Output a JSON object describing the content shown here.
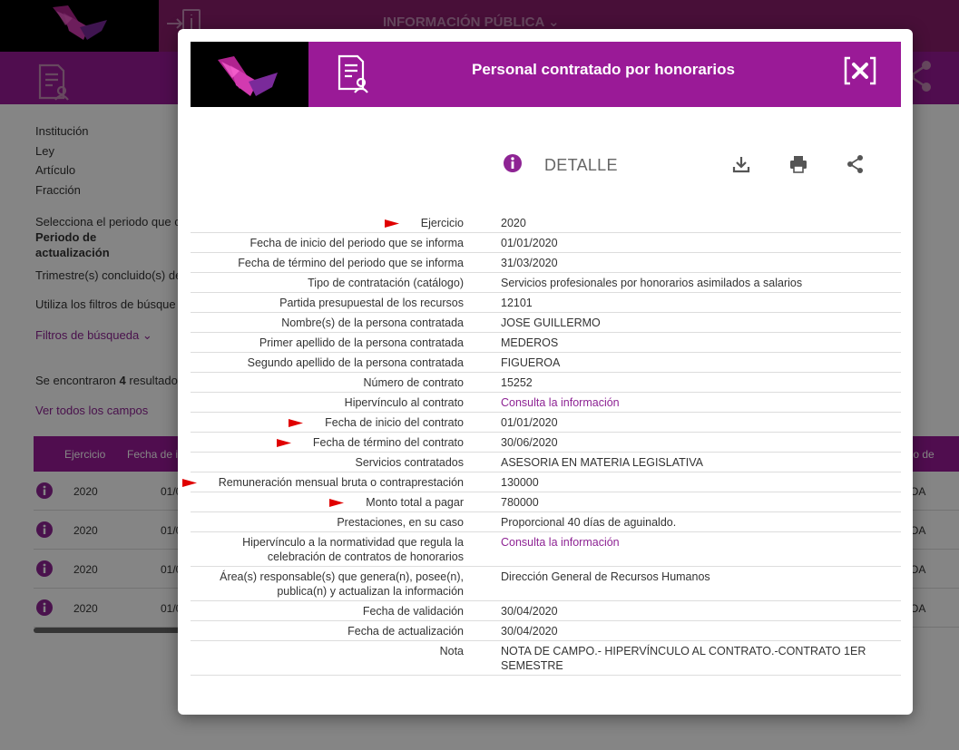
{
  "nav": {
    "section_label": "INFORMACIÓN PÚBLICA"
  },
  "background": {
    "fields": [
      "Institución",
      "Ley",
      "Artículo",
      "Fracción"
    ],
    "period_select_text": "Selecciona el periodo que c",
    "period_label_line1": "Periodo de",
    "period_label_line2": "actualización",
    "quarter_text": "Trimestre(s) concluido(s) de",
    "filters_hint": "Utiliza los filtros de búsque",
    "filters_link": "Filtros de búsqueda",
    "results_prefix": "Se encontraron",
    "results_count": "4",
    "results_suffix": "resultado",
    "see_all_link": "Ver todos los campos",
    "table_headers": [
      "Ejercicio",
      "Fecha de ini",
      "ido de"
    ],
    "table_rows": [
      {
        "year": "2020",
        "date": "01/0",
        "tail": "OA"
      },
      {
        "year": "2020",
        "date": "01/0",
        "tail": "OA"
      },
      {
        "year": "2020",
        "date": "01/0",
        "tail": "OA"
      },
      {
        "year": "2020",
        "date": "01/0",
        "tail": "OA"
      }
    ]
  },
  "modal": {
    "title": "Personal contratado por honorarios",
    "detail_title": "DETALLE",
    "colors": {
      "accent": "#9a1a97",
      "link": "#8e2494",
      "flag": "#e00000"
    },
    "rows": [
      {
        "label": "Ejercicio",
        "value": "2020",
        "flag": true
      },
      {
        "label": "Fecha de inicio del periodo que se informa",
        "value": "01/01/2020"
      },
      {
        "label": "Fecha de término del periodo que se informa",
        "value": "31/03/2020"
      },
      {
        "label": "Tipo de contratación (catálogo)",
        "value": "Servicios profesionales por honorarios asimilados a salarios"
      },
      {
        "label": "Partida presupuestal de los recursos",
        "value": "12101"
      },
      {
        "label": "Nombre(s) de la persona contratada",
        "value": "JOSE GUILLERMO"
      },
      {
        "label": "Primer apellido de la persona contratada",
        "value": "MEDEROS"
      },
      {
        "label": "Segundo apellido de la persona contratada",
        "value": "FIGUEROA"
      },
      {
        "label": "Número de contrato",
        "value": "15252"
      },
      {
        "label": "Hipervínculo al contrato",
        "value": "Consulta la información",
        "link": true
      },
      {
        "label": "Fecha de inicio del contrato",
        "value": "01/01/2020",
        "flag": true
      },
      {
        "label": "Fecha de término del contrato",
        "value": "30/06/2020",
        "flag": true
      },
      {
        "label": "Servicios contratados",
        "value": "ASESORIA EN MATERIA LEGISLATIVA"
      },
      {
        "label": "Remuneración mensual bruta o contraprestación",
        "value": "130000",
        "flag": true
      },
      {
        "label": "Monto total a pagar",
        "value": "780000",
        "flag": true
      },
      {
        "label": "Prestaciones, en su caso",
        "value": "Proporcional 40 días de aguinaldo."
      },
      {
        "label": "Hipervínculo a la normatividad que regula la celebración de contratos de honorarios",
        "value": "Consulta la información",
        "link": true
      },
      {
        "label": "Área(s) responsable(s) que genera(n), posee(n), publica(n) y actualizan la información",
        "value": "Dirección General de Recursos Humanos"
      },
      {
        "label": "Fecha de validación",
        "value": "30/04/2020"
      },
      {
        "label": "Fecha de actualización",
        "value": "30/04/2020"
      },
      {
        "label": "Nota",
        "value": "NOTA DE CAMPO.- HIPERVÍNCULO AL CONTRATO.-CONTRATO 1ER SEMESTRE"
      }
    ]
  }
}
